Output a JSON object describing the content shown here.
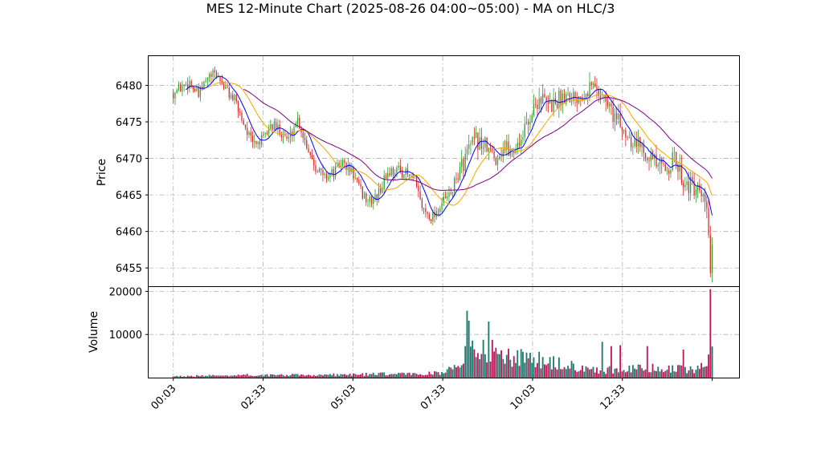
{
  "chart_data": {
    "type": "candlestick",
    "title": "MES 12-Minute Chart (2025-08-26 04:00~05:00) - MA on HLC/3",
    "price_panel": {
      "ylabel": "Price",
      "ylim": [
        6452.5,
        6484
      ],
      "yticks": [
        6455,
        6460,
        6465,
        6470,
        6475,
        6480
      ],
      "grid": true
    },
    "volume_panel": {
      "ylabel": "Volume",
      "ylim": [
        0,
        21000
      ],
      "yticks": [
        10000,
        20000
      ],
      "grid": true
    },
    "x_axis": {
      "type": "time",
      "range": [
        "00:03",
        "15:03"
      ],
      "tick_labels": [
        "00:03",
        "02:33",
        "05:03",
        "07:33",
        "10:03",
        "12:33"
      ],
      "tick_label_rotation": 45
    },
    "colors": {
      "up": "#2ca02c",
      "down": "#d62728",
      "ma_fast": "#0000ff",
      "ma_mid": "#ffa500",
      "ma_slow": "#800080",
      "vol_up": "#1f7a6e",
      "vol_down": "#c2185b"
    },
    "price_path": [
      [
        "00:03",
        6479.0
      ],
      [
        "00:30",
        6480.5
      ],
      [
        "00:45",
        6478.5
      ],
      [
        "01:00",
        6481.0
      ],
      [
        "01:15",
        6481.5
      ],
      [
        "01:30",
        6479.5
      ],
      [
        "01:45",
        6478.0
      ],
      [
        "02:00",
        6475.0
      ],
      [
        "02:15",
        6472.0
      ],
      [
        "02:33",
        6472.5
      ],
      [
        "02:45",
        6474.5
      ],
      [
        "03:00",
        6474.0
      ],
      [
        "03:15",
        6472.5
      ],
      [
        "03:30",
        6475.5
      ],
      [
        "03:45",
        6472.0
      ],
      [
        "04:00",
        6469.0
      ],
      [
        "04:15",
        6467.5
      ],
      [
        "04:30",
        6468.0
      ],
      [
        "04:45",
        6469.5
      ],
      [
        "05:03",
        6468.0
      ],
      [
        "05:15",
        6465.5
      ],
      [
        "05:30",
        6464.0
      ],
      [
        "05:45",
        6465.0
      ],
      [
        "06:00",
        6468.0
      ],
      [
        "06:15",
        6468.5
      ],
      [
        "06:30",
        6468.0
      ],
      [
        "06:45",
        6467.0
      ],
      [
        "07:00",
        6463.0
      ],
      [
        "07:15",
        6462.0
      ],
      [
        "07:33",
        6464.0
      ],
      [
        "07:45",
        6465.0
      ],
      [
        "08:00",
        6468.0
      ],
      [
        "08:15",
        6471.0
      ],
      [
        "08:30",
        6472.5
      ],
      [
        "08:45",
        6471.5
      ],
      [
        "09:00",
        6470.0
      ],
      [
        "09:15",
        6471.5
      ],
      [
        "09:30",
        6471.0
      ],
      [
        "09:45",
        6473.0
      ],
      [
        "10:03",
        6476.5
      ],
      [
        "10:15",
        6478.5
      ],
      [
        "10:30",
        6477.0
      ],
      [
        "10:45",
        6478.0
      ],
      [
        "11:00",
        6479.0
      ],
      [
        "11:15",
        6478.5
      ],
      [
        "11:30",
        6479.5
      ],
      [
        "11:45",
        6480.0
      ],
      [
        "12:00",
        6478.5
      ],
      [
        "12:15",
        6476.5
      ],
      [
        "12:33",
        6474.0
      ],
      [
        "12:45",
        6473.0
      ],
      [
        "13:00",
        6472.0
      ],
      [
        "13:15",
        6471.0
      ],
      [
        "13:30",
        6469.0
      ],
      [
        "13:45",
        6468.5
      ],
      [
        "14:00",
        6470.0
      ],
      [
        "14:15",
        6467.0
      ],
      [
        "14:30",
        6466.0
      ],
      [
        "14:45",
        6464.5
      ],
      [
        "14:55",
        6463.0
      ],
      [
        "15:00",
        6454.5
      ],
      [
        "15:03",
        6457.0
      ]
    ],
    "volume_path": [
      [
        "00:03",
        300
      ],
      [
        "02:00",
        600
      ],
      [
        "04:00",
        600
      ],
      [
        "05:30",
        800
      ],
      [
        "07:00",
        900
      ],
      [
        "07:30",
        1200
      ],
      [
        "08:00",
        2500
      ],
      [
        "08:15",
        9000
      ],
      [
        "08:45",
        6500
      ],
      [
        "09:30",
        5000
      ],
      [
        "10:30",
        3500
      ],
      [
        "11:30",
        2300
      ],
      [
        "12:00",
        1700
      ],
      [
        "12:30",
        2000
      ],
      [
        "13:30",
        2200
      ],
      [
        "14:30",
        1800
      ],
      [
        "14:55",
        3500
      ],
      [
        "15:03",
        7000
      ]
    ],
    "volume_spikes": [
      [
        "08:15",
        15500
      ],
      [
        "08:50",
        13000
      ],
      [
        "10:15",
        6000
      ],
      [
        "12:00",
        8300
      ],
      [
        "12:15",
        7300
      ],
      [
        "12:30",
        7500
      ],
      [
        "13:15",
        7300
      ],
      [
        "14:15",
        6500
      ],
      [
        "15:00",
        20500
      ]
    ]
  }
}
